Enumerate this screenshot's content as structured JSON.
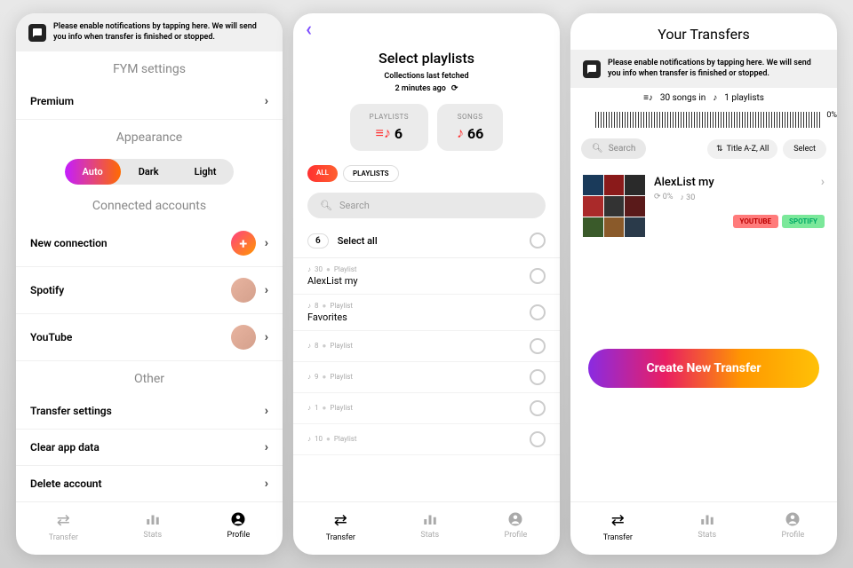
{
  "banner": {
    "text": "Please enable notifications by tapping here. We will send you info when transfer is finished or stopped."
  },
  "screen1": {
    "title1": "FYM settings",
    "premium": "Premium",
    "title2": "Appearance",
    "pills": {
      "auto": "Auto",
      "dark": "Dark",
      "light": "Light"
    },
    "title3": "Connected accounts",
    "newConnection": "New connection",
    "spotify": "Spotify",
    "youtube": "YouTube",
    "title4": "Other",
    "transferSettings": "Transfer settings",
    "clearData": "Clear app data",
    "deleteAccount": "Delete account"
  },
  "screen2": {
    "title": "Select playlists",
    "sub1": "Collections last fetched",
    "sub2": "2 minutes ago",
    "stats": {
      "playlistsLabel": "PLAYLISTS",
      "playlistsValue": "6",
      "songsLabel": "SONGS",
      "songsValue": "66"
    },
    "filters": {
      "all": "ALL",
      "playlists": "PLAYLISTS"
    },
    "searchPlaceholder": "Search",
    "selectAll": {
      "count": "6",
      "label": "Select all"
    },
    "playlists": [
      {
        "songs": "30",
        "type": "Playlist",
        "name": "AlexList my"
      },
      {
        "songs": "8",
        "type": "Playlist",
        "name": "Favorites"
      },
      {
        "songs": "8",
        "type": "Playlist",
        "name": ""
      },
      {
        "songs": "9",
        "type": "Playlist",
        "name": ""
      },
      {
        "songs": "1",
        "type": "Playlist",
        "name": ""
      },
      {
        "songs": "10",
        "type": "Playlist",
        "name": ""
      }
    ]
  },
  "screen3": {
    "title": "Your Transfers",
    "summary": {
      "songs": "30 songs in",
      "playlists": "1 playlists"
    },
    "progress": "0%",
    "search": "Search",
    "sort": "Title A-Z, All",
    "select": "Select",
    "card": {
      "title": "AlexList my",
      "pct": "0%",
      "songs": "30",
      "ytBadge": "YOUTUBE",
      "spBadge": "SPOTIFY"
    },
    "cta": "Create New Transfer"
  },
  "nav": {
    "transfer": "Transfer",
    "stats": "Stats",
    "profile": "Profile"
  }
}
